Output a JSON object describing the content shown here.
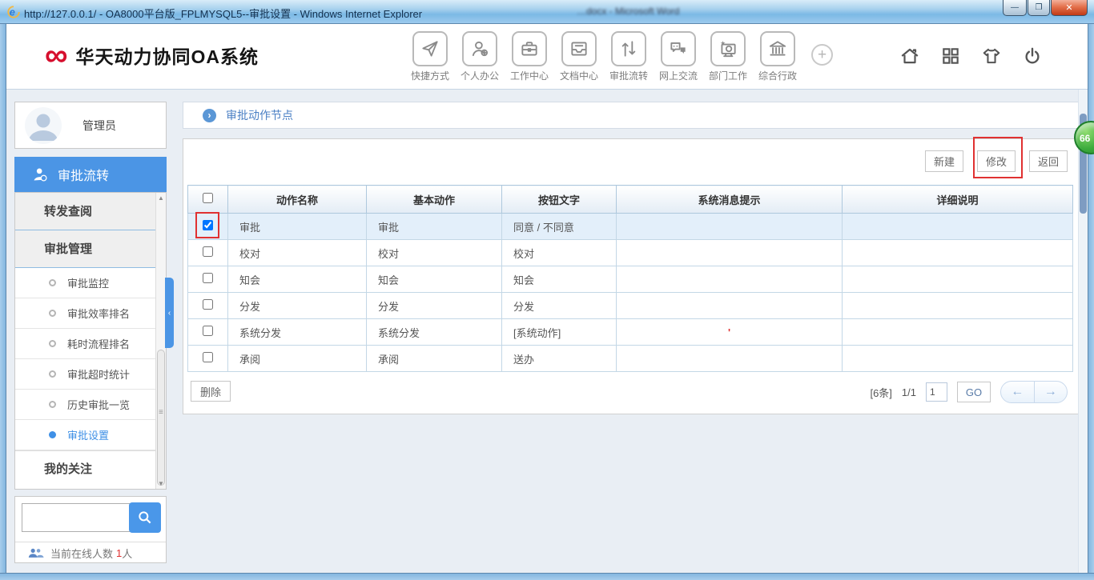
{
  "window": {
    "title": "http://127.0.0.1/ - OA8000平台版_FPLMYSQL5--审批设置 - Windows Internet Explorer",
    "background_window_title": "…docx - Microsoft Word",
    "controls": {
      "minimize": "—",
      "maximize": "❐",
      "close": "✕"
    }
  },
  "header": {
    "logo_symbol": "∞",
    "logo_text": "华天动力协同OA系统",
    "nav": [
      {
        "label": "快捷方式",
        "icon": "paper-plane-icon"
      },
      {
        "label": "个人办公",
        "icon": "person-add-icon"
      },
      {
        "label": "工作中心",
        "icon": "briefcase-icon"
      },
      {
        "label": "文档中心",
        "icon": "document-tray-icon"
      },
      {
        "label": "审批流转",
        "icon": "arrows-updown-icon"
      },
      {
        "label": "网上交流",
        "icon": "chat-bubbles-icon"
      },
      {
        "label": "部门工作",
        "icon": "department-screen-icon"
      },
      {
        "label": "综合行政",
        "icon": "bank-icon"
      }
    ],
    "quick_add_symbol": "+",
    "right_icons": [
      "home-icon",
      "apps-grid-icon",
      "tshirt-theme-icon",
      "power-icon"
    ]
  },
  "sidebar": {
    "user_name": "管理员",
    "module": {
      "label": "审批流转",
      "icon": "person-badge-icon"
    },
    "groups": [
      {
        "label": "转发查阅"
      },
      {
        "label": "审批管理"
      }
    ],
    "sub_items": [
      {
        "label": "审批监控",
        "active": false
      },
      {
        "label": "审批效率排名",
        "active": false
      },
      {
        "label": "耗时流程排名",
        "active": false
      },
      {
        "label": "审批超时统计",
        "active": false
      },
      {
        "label": "历史审批一览",
        "active": false
      },
      {
        "label": "审批设置",
        "active": true
      }
    ],
    "bottom_group": "我的关注",
    "search": {
      "value": ""
    },
    "online": {
      "label": "当前在线人数",
      "count": "1",
      "unit": "人"
    }
  },
  "main": {
    "page_title": "审批动作节点",
    "toolbar": {
      "new": "新建",
      "modify": "修改",
      "back": "返回"
    },
    "table": {
      "columns": [
        "动作名称",
        "基本动作",
        "按钮文字",
        "系统消息提示",
        "详细说明"
      ],
      "rows": [
        {
          "checked": true,
          "selected": true,
          "name": "审批",
          "base": "审批",
          "button": "同意 / 不同意",
          "msg": "",
          "desc": ""
        },
        {
          "checked": false,
          "selected": false,
          "name": "校对",
          "base": "校对",
          "button": "校对",
          "msg": "",
          "desc": ""
        },
        {
          "checked": false,
          "selected": false,
          "name": "知会",
          "base": "知会",
          "button": "知会",
          "msg": "",
          "desc": ""
        },
        {
          "checked": false,
          "selected": false,
          "name": "分发",
          "base": "分发",
          "button": "分发",
          "msg": "",
          "desc": ""
        },
        {
          "checked": false,
          "selected": false,
          "name": "系统分发",
          "base": "系统分发",
          "button": "[系统动作]",
          "msg": "'",
          "desc": ""
        },
        {
          "checked": false,
          "selected": false,
          "name": "承阅",
          "base": "承阅",
          "button": "送办",
          "msg": "",
          "desc": ""
        }
      ]
    },
    "footer": {
      "delete": "删除",
      "total": "[6条]",
      "page": "1/1",
      "page_input": "1",
      "go": "GO"
    }
  },
  "floating_badge": {
    "count": "66"
  },
  "colors": {
    "accent_blue": "#4a95e6",
    "link_blue": "#4a7fc4",
    "annotation_red": "#e03131",
    "selected_row": "#e3effa",
    "badge_green": "#3cab3c",
    "logo_red": "#d60f2e"
  }
}
